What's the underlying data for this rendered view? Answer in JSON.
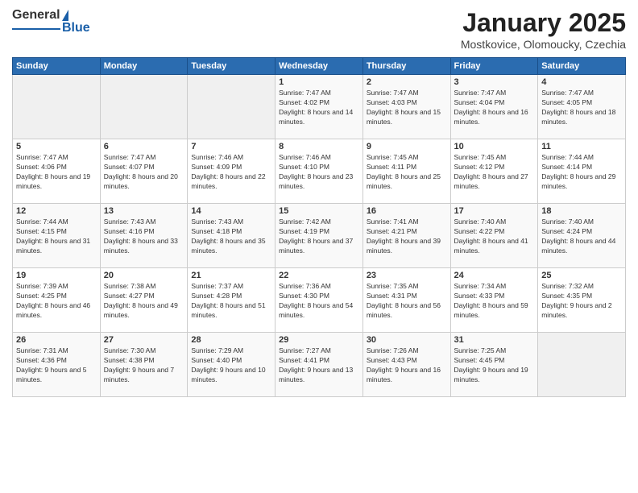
{
  "header": {
    "logo": {
      "line1": "General",
      "line2": "Blue"
    },
    "title": "January 2025",
    "location": "Mostkovice, Olomoucky, Czechia"
  },
  "weekdays": [
    "Sunday",
    "Monday",
    "Tuesday",
    "Wednesday",
    "Thursday",
    "Friday",
    "Saturday"
  ],
  "weeks": [
    [
      {
        "day": "",
        "empty": true
      },
      {
        "day": "",
        "empty": true
      },
      {
        "day": "",
        "empty": true
      },
      {
        "day": "1",
        "sunrise": "7:47 AM",
        "sunset": "4:02 PM",
        "daylight": "8 hours and 14 minutes."
      },
      {
        "day": "2",
        "sunrise": "7:47 AM",
        "sunset": "4:03 PM",
        "daylight": "8 hours and 15 minutes."
      },
      {
        "day": "3",
        "sunrise": "7:47 AM",
        "sunset": "4:04 PM",
        "daylight": "8 hours and 16 minutes."
      },
      {
        "day": "4",
        "sunrise": "7:47 AM",
        "sunset": "4:05 PM",
        "daylight": "8 hours and 18 minutes."
      }
    ],
    [
      {
        "day": "5",
        "sunrise": "7:47 AM",
        "sunset": "4:06 PM",
        "daylight": "8 hours and 19 minutes."
      },
      {
        "day": "6",
        "sunrise": "7:47 AM",
        "sunset": "4:07 PM",
        "daylight": "8 hours and 20 minutes."
      },
      {
        "day": "7",
        "sunrise": "7:46 AM",
        "sunset": "4:09 PM",
        "daylight": "8 hours and 22 minutes."
      },
      {
        "day": "8",
        "sunrise": "7:46 AM",
        "sunset": "4:10 PM",
        "daylight": "8 hours and 23 minutes."
      },
      {
        "day": "9",
        "sunrise": "7:45 AM",
        "sunset": "4:11 PM",
        "daylight": "8 hours and 25 minutes."
      },
      {
        "day": "10",
        "sunrise": "7:45 AM",
        "sunset": "4:12 PM",
        "daylight": "8 hours and 27 minutes."
      },
      {
        "day": "11",
        "sunrise": "7:44 AM",
        "sunset": "4:14 PM",
        "daylight": "8 hours and 29 minutes."
      }
    ],
    [
      {
        "day": "12",
        "sunrise": "7:44 AM",
        "sunset": "4:15 PM",
        "daylight": "8 hours and 31 minutes."
      },
      {
        "day": "13",
        "sunrise": "7:43 AM",
        "sunset": "4:16 PM",
        "daylight": "8 hours and 33 minutes."
      },
      {
        "day": "14",
        "sunrise": "7:43 AM",
        "sunset": "4:18 PM",
        "daylight": "8 hours and 35 minutes."
      },
      {
        "day": "15",
        "sunrise": "7:42 AM",
        "sunset": "4:19 PM",
        "daylight": "8 hours and 37 minutes."
      },
      {
        "day": "16",
        "sunrise": "7:41 AM",
        "sunset": "4:21 PM",
        "daylight": "8 hours and 39 minutes."
      },
      {
        "day": "17",
        "sunrise": "7:40 AM",
        "sunset": "4:22 PM",
        "daylight": "8 hours and 41 minutes."
      },
      {
        "day": "18",
        "sunrise": "7:40 AM",
        "sunset": "4:24 PM",
        "daylight": "8 hours and 44 minutes."
      }
    ],
    [
      {
        "day": "19",
        "sunrise": "7:39 AM",
        "sunset": "4:25 PM",
        "daylight": "8 hours and 46 minutes."
      },
      {
        "day": "20",
        "sunrise": "7:38 AM",
        "sunset": "4:27 PM",
        "daylight": "8 hours and 49 minutes."
      },
      {
        "day": "21",
        "sunrise": "7:37 AM",
        "sunset": "4:28 PM",
        "daylight": "8 hours and 51 minutes."
      },
      {
        "day": "22",
        "sunrise": "7:36 AM",
        "sunset": "4:30 PM",
        "daylight": "8 hours and 54 minutes."
      },
      {
        "day": "23",
        "sunrise": "7:35 AM",
        "sunset": "4:31 PM",
        "daylight": "8 hours and 56 minutes."
      },
      {
        "day": "24",
        "sunrise": "7:34 AM",
        "sunset": "4:33 PM",
        "daylight": "8 hours and 59 minutes."
      },
      {
        "day": "25",
        "sunrise": "7:32 AM",
        "sunset": "4:35 PM",
        "daylight": "9 hours and 2 minutes."
      }
    ],
    [
      {
        "day": "26",
        "sunrise": "7:31 AM",
        "sunset": "4:36 PM",
        "daylight": "9 hours and 5 minutes."
      },
      {
        "day": "27",
        "sunrise": "7:30 AM",
        "sunset": "4:38 PM",
        "daylight": "9 hours and 7 minutes."
      },
      {
        "day": "28",
        "sunrise": "7:29 AM",
        "sunset": "4:40 PM",
        "daylight": "9 hours and 10 minutes."
      },
      {
        "day": "29",
        "sunrise": "7:27 AM",
        "sunset": "4:41 PM",
        "daylight": "9 hours and 13 minutes."
      },
      {
        "day": "30",
        "sunrise": "7:26 AM",
        "sunset": "4:43 PM",
        "daylight": "9 hours and 16 minutes."
      },
      {
        "day": "31",
        "sunrise": "7:25 AM",
        "sunset": "4:45 PM",
        "daylight": "9 hours and 19 minutes."
      },
      {
        "day": "",
        "empty": true
      }
    ]
  ]
}
